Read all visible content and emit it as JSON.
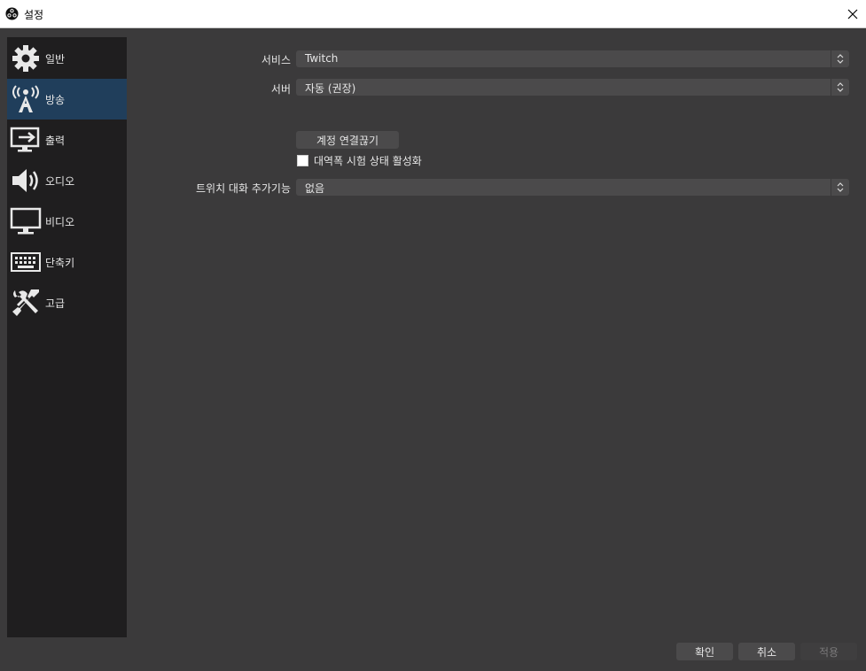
{
  "window": {
    "title": "설정",
    "close_icon": "close-icon"
  },
  "sidebar": {
    "items": [
      {
        "label": "일반",
        "icon": "gear-icon",
        "active": false
      },
      {
        "label": "방송",
        "icon": "broadcast-tower-icon",
        "active": true
      },
      {
        "label": "출력",
        "icon": "output-icon",
        "active": false
      },
      {
        "label": "오디오",
        "icon": "speaker-icon",
        "active": false
      },
      {
        "label": "비디오",
        "icon": "monitor-icon",
        "active": false
      },
      {
        "label": "단축키",
        "icon": "keyboard-icon",
        "active": false
      },
      {
        "label": "고급",
        "icon": "tools-icon",
        "active": false
      }
    ]
  },
  "stream": {
    "service_label": "서비스",
    "service_value": "Twitch",
    "server_label": "서버",
    "server_value": "자동 (권장)",
    "disconnect_button": "계정 연결끊기",
    "bandwidth_test_label": "대역폭 시험 상태 활성화",
    "bandwidth_test_checked": false,
    "chat_addon_label": "트위치 대화 추가기능",
    "chat_addon_value": "없음"
  },
  "footer": {
    "ok_label": "확인",
    "cancel_label": "취소",
    "apply_label": "적용"
  },
  "colors": {
    "background": "#3b3a3b",
    "sidebar": "#1f1e1f",
    "active_item": "#203e5b",
    "control": "#4b4a4b",
    "text": "#e6e6e6"
  }
}
